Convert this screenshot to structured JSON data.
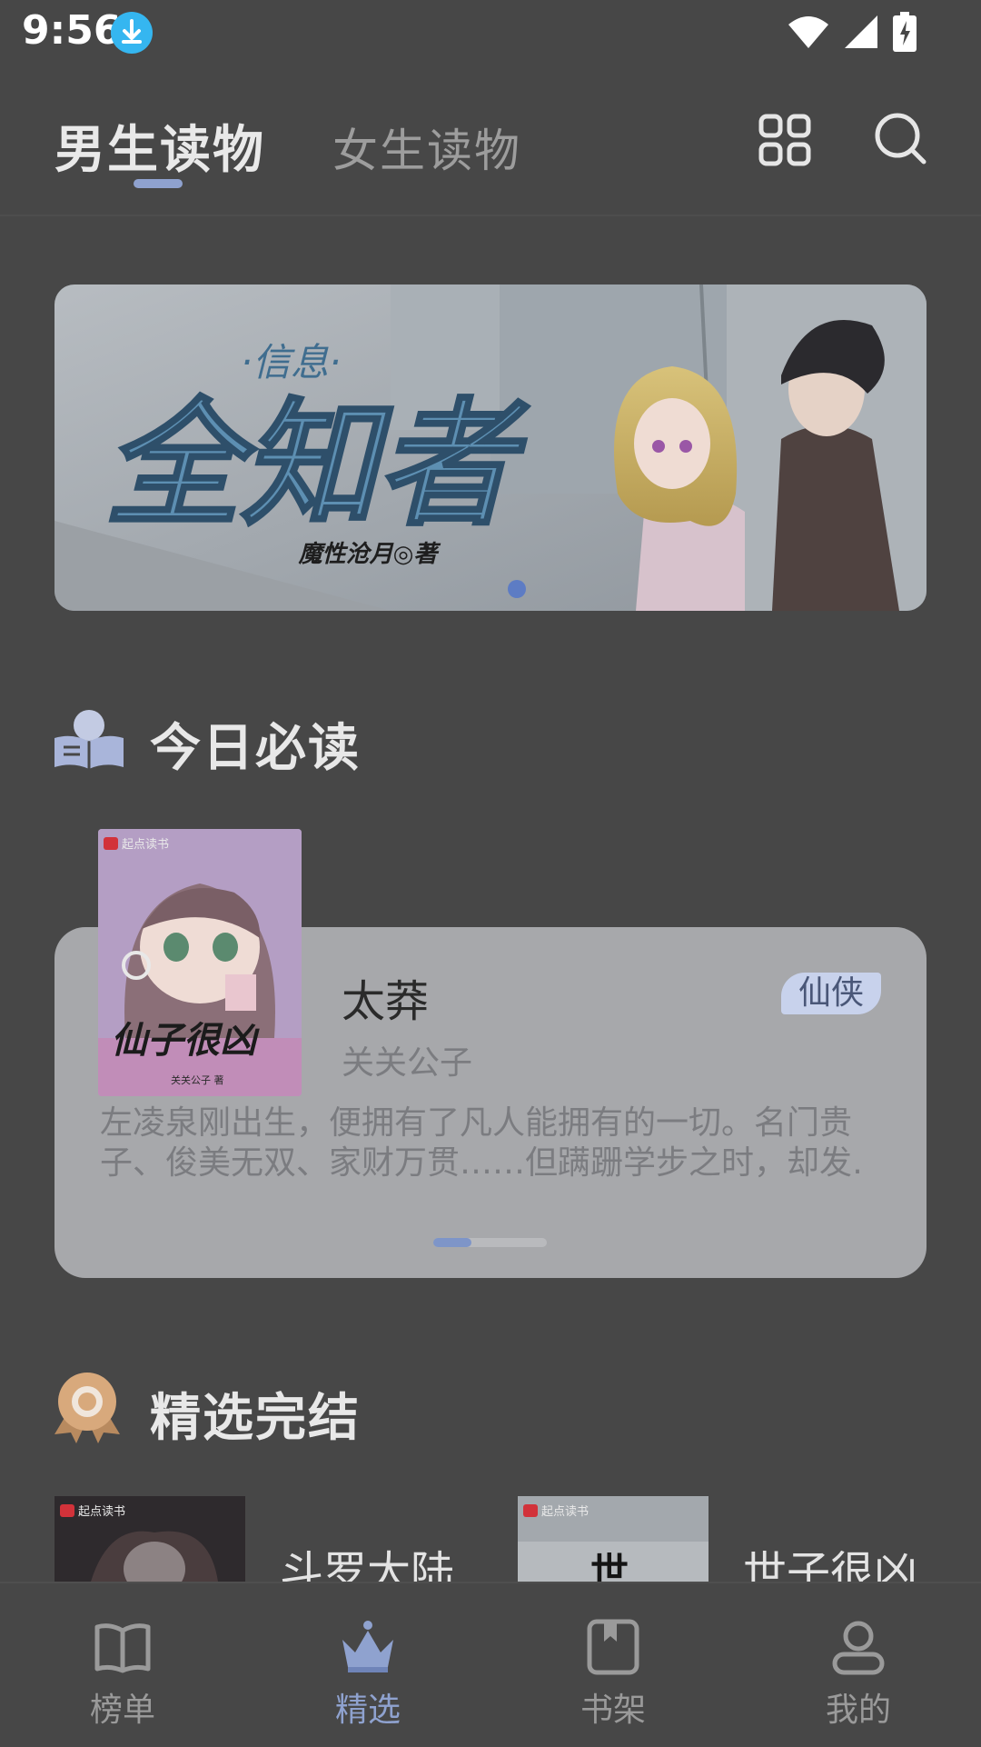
{
  "status_bar": {
    "time": "9:56"
  },
  "header": {
    "tabs": [
      {
        "label": "男生读物",
        "active": true
      },
      {
        "label": "女生读物",
        "active": false
      }
    ]
  },
  "banner": {
    "title_art": "全知者",
    "subtitle_art": "·信息·",
    "author_art": "魔性沧月◎著"
  },
  "sections": {
    "must_read": {
      "title": "今日必读"
    },
    "completed": {
      "title": "精选完结"
    }
  },
  "featured_book": {
    "cover_brand": "起点读书",
    "cover_title": "仙子很凶",
    "cover_author": "关关公子 著",
    "title": "太莽",
    "author": "关关公子",
    "genre": "仙侠",
    "description_lines": [
      "左凌泉刚出生，便拥有了凡人能拥有的一切。名门贵",
      "子、俊美无双、家财万贯……但蹒跚学步之时，却发…"
    ]
  },
  "completed_books": [
    {
      "title": "斗罗大陆",
      "cover_brand": "起点读书"
    },
    {
      "title": "世子很凶",
      "cover_brand": "起点读书",
      "cover_char": "世"
    }
  ],
  "bottom_nav": [
    {
      "label": "榜单",
      "active": false
    },
    {
      "label": "精选",
      "active": true
    },
    {
      "label": "书架",
      "active": false
    },
    {
      "label": "我的",
      "active": false
    }
  ],
  "colors": {
    "background": "#474747",
    "accent": "#8fa2cf",
    "card": "#a7a8ab",
    "tag_bg": "#c8d2ec"
  }
}
